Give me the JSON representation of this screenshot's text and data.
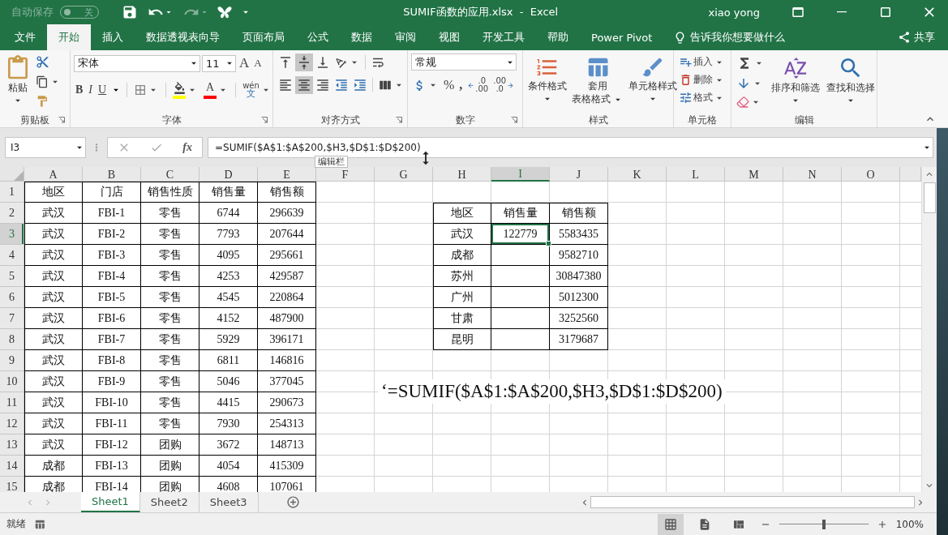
{
  "title_bar": {
    "autosave": {
      "label": "自动保存",
      "toggle_text": "关",
      "on": false
    },
    "title": "SUMIF函数的应用.xlsx  -  Excel",
    "user": "xiao yong"
  },
  "menu_tabs": [
    {
      "label": "文件",
      "selected": false
    },
    {
      "label": "开始",
      "selected": true
    },
    {
      "label": "插入",
      "selected": false
    },
    {
      "label": "数据透视表向导",
      "selected": false
    },
    {
      "label": "页面布局",
      "selected": false
    },
    {
      "label": "公式",
      "selected": false
    },
    {
      "label": "数据",
      "selected": false
    },
    {
      "label": "审阅",
      "selected": false
    },
    {
      "label": "视图",
      "selected": false
    },
    {
      "label": "开发工具",
      "selected": false
    },
    {
      "label": "帮助",
      "selected": false
    },
    {
      "label": "Power Pivot",
      "selected": false
    }
  ],
  "tell_me": "告诉我你想要做什么",
  "share": "共享",
  "ribbon": {
    "clipboard": {
      "paste": "粘贴",
      "label": "剪贴板"
    },
    "font": {
      "name": "宋体",
      "size": "11",
      "grow": "A",
      "shrink": "A",
      "bold": "B",
      "italic": "I",
      "underline": "U",
      "font_color": "A",
      "phonetic_top": "wén",
      "phonetic_bottom": "文",
      "label": "字体"
    },
    "alignment": {
      "label": "对齐方式",
      "vertical": [
        {
          "kind": "top",
          "selected": false
        },
        {
          "kind": "middle",
          "selected": true
        },
        {
          "kind": "bottom",
          "selected": false
        }
      ],
      "horizontal": [
        {
          "kind": "left",
          "selected": false
        },
        {
          "kind": "center",
          "selected": true
        },
        {
          "kind": "right",
          "selected": false
        }
      ]
    },
    "number": {
      "format": "常规",
      "percent": "%",
      "comma": ",",
      "increase_decimal": [
        ".0",
        ".00"
      ],
      "decrease_decimal": [
        ".00",
        ".0"
      ],
      "label": "数字"
    },
    "styles": {
      "conditional": "条件格式",
      "table_format": [
        "套用",
        "表格格式"
      ],
      "cell_styles": "单元格样式",
      "label": "样式"
    },
    "cells": {
      "insert": "插入",
      "delete": "删除",
      "format": "格式",
      "label": "单元格"
    },
    "editing": {
      "sort": "排序和筛选",
      "find": "查找和选择",
      "label": "编辑"
    }
  },
  "formula_bar": {
    "name_box": "I3",
    "fx": "fx",
    "formula": "=SUMIF($A$1:$A$200,$H3,$D$1:$D$200)",
    "tooltip": "编辑栏"
  },
  "sheet": {
    "columns": [
      "A",
      "B",
      "C",
      "D",
      "E",
      "F",
      "G",
      "H",
      "I",
      "J",
      "K",
      "L",
      "M",
      "N",
      "O"
    ],
    "row_numbers": [
      "1",
      "2",
      "3",
      "4",
      "5",
      "6",
      "7",
      "8",
      "9",
      "10",
      "11",
      "12",
      "13",
      "14",
      "15"
    ],
    "rows": [
      [
        "地区",
        "门店",
        "销售性质",
        "销售量",
        "销售额"
      ],
      [
        "武汉",
        "FBI-1",
        "零售",
        "6744",
        "296639"
      ],
      [
        "武汉",
        "FBI-2",
        "零售",
        "7793",
        "207644"
      ],
      [
        "武汉",
        "FBI-3",
        "零售",
        "4095",
        "295661"
      ],
      [
        "武汉",
        "FBI-4",
        "零售",
        "4253",
        "429587"
      ],
      [
        "武汉",
        "FBI-5",
        "零售",
        "4545",
        "220864"
      ],
      [
        "武汉",
        "FBI-6",
        "零售",
        "4152",
        "487900"
      ],
      [
        "武汉",
        "FBI-7",
        "零售",
        "5929",
        "396171"
      ],
      [
        "武汉",
        "FBI-8",
        "零售",
        "6811",
        "146816"
      ],
      [
        "武汉",
        "FBI-9",
        "零售",
        "5046",
        "377045"
      ],
      [
        "武汉",
        "FBI-10",
        "零售",
        "4415",
        "290673"
      ],
      [
        "武汉",
        "FBI-11",
        "零售",
        "7930",
        "254313"
      ],
      [
        "武汉",
        "FBI-12",
        "团购",
        "3672",
        "148713"
      ],
      [
        "成都",
        "FBI-13",
        "团购",
        "4054",
        "415309"
      ],
      [
        "成都",
        "FBI-14",
        "团购",
        "4608",
        "107061"
      ]
    ]
  },
  "summary": {
    "rows": [
      {
        "cells": [
          {
            "text": "地区",
            "selected": false
          },
          {
            "text": "销售量",
            "selected": false
          },
          {
            "text": "销售额",
            "selected": false
          }
        ]
      },
      {
        "cells": [
          {
            "text": "武汉",
            "selected": false
          },
          {
            "text": "122779",
            "selected": true
          },
          {
            "text": "5583435",
            "selected": false
          }
        ]
      },
      {
        "cells": [
          {
            "text": "成都",
            "selected": false
          },
          {
            "selected": false
          },
          {
            "text": "9582710",
            "selected": false
          }
        ]
      },
      {
        "cells": [
          {
            "text": "苏州",
            "selected": false
          },
          {
            "selected": false
          },
          {
            "text": "30847380",
            "selected": false
          }
        ]
      },
      {
        "cells": [
          {
            "text": "广州",
            "selected": false
          },
          {
            "selected": false
          },
          {
            "text": "5012300",
            "selected": false
          }
        ]
      },
      {
        "cells": [
          {
            "text": "甘肃",
            "selected": false
          },
          {
            "selected": false
          },
          {
            "text": "3252560",
            "selected": false
          }
        ]
      },
      {
        "cells": [
          {
            "text": "昆明",
            "selected": false
          },
          {
            "selected": false
          },
          {
            "text": "3179687",
            "selected": false
          }
        ]
      }
    ]
  },
  "note": "‘=SUMIF($A$1:$A$200,$H3,$D$1:$D$200)",
  "sheet_tabs": [
    {
      "label": "Sheet1",
      "selected": true
    },
    {
      "label": "Sheet2",
      "selected": false
    },
    {
      "label": "Sheet3",
      "selected": false
    }
  ],
  "status": {
    "text": "就绪",
    "views": [
      {
        "kind": "normal",
        "selected": true
      },
      {
        "kind": "page_layout",
        "selected": false
      },
      {
        "kind": "page_break",
        "selected": false
      }
    ],
    "zoom": {
      "level": 0.5,
      "text": "100%"
    }
  }
}
